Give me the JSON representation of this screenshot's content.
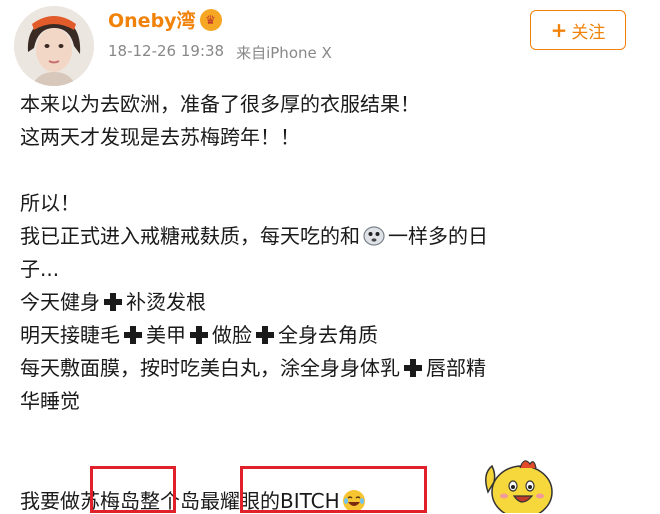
{
  "user": {
    "name": "Oneby湾",
    "badge_icon": "vip-badge-icon",
    "timestamp": "18-12-26 19:38",
    "source": "来自iPhone X"
  },
  "follow_button": {
    "plus": "+",
    "label": "关注"
  },
  "post": {
    "line1": "本来以为去欧洲，准备了很多厚的衣服结果！",
    "line2": "这两天才发现是去苏梅跨年！！",
    "line3": "所以！",
    "line4a": "我已正式进入戒糖戒麸质，每天吃的和",
    "line4b": "一样多的日",
    "line5": "子...",
    "line6a": "今天健身",
    "line6b": "补烫发根",
    "line7a": "明天接睫毛",
    "line7b": "美甲",
    "line7c": "做脸",
    "line7d": "全身去角质",
    "line8a": "每天敷面膜，按时吃美白丸，涂全身身体乳",
    "line8b": "唇部精",
    "line9": "华睡觉",
    "line10a": "我要做",
    "line10b": "苏梅岛",
    "line10c": "整个岛",
    "line10d": "最耀眼的BITCH"
  },
  "colors": {
    "accent": "#f0820a",
    "highlight_box": "#e0202a"
  }
}
